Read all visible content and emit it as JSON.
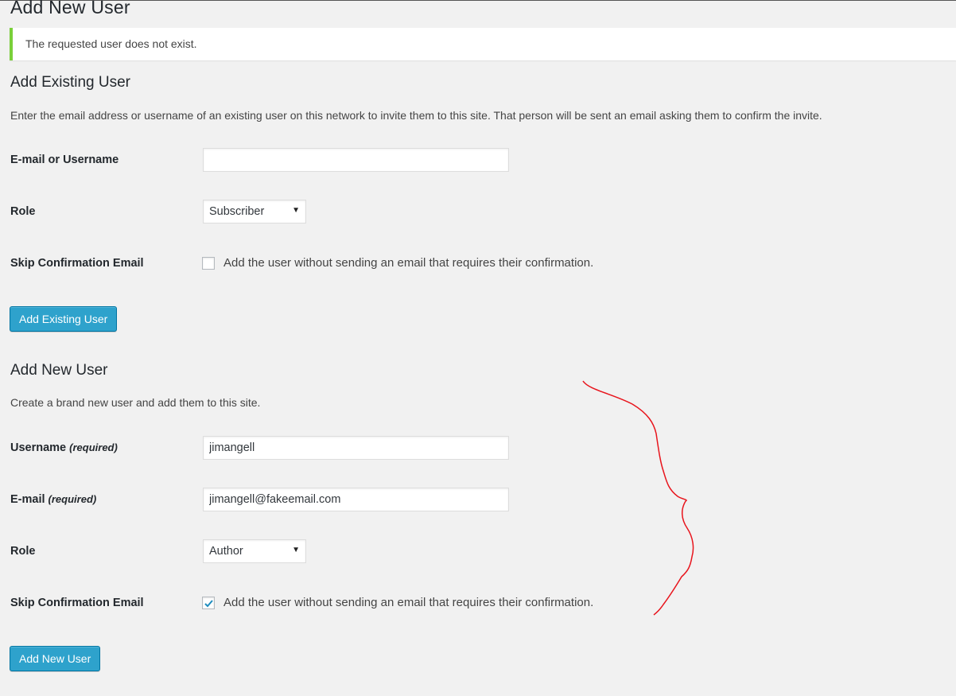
{
  "page_title": "Add New User",
  "notice": {
    "message": "The requested user does not exist.",
    "accent_color": "#7ad03a"
  },
  "add_existing": {
    "heading": "Add Existing User",
    "description": "Enter the email address or username of an existing user on this network to invite them to this site. That person will be sent an email asking them to confirm the invite.",
    "email_label": "E-mail or Username",
    "email_value": "",
    "role_label": "Role",
    "role_value": "Subscriber",
    "skip_label": "Skip Confirmation Email",
    "skip_checked": false,
    "skip_text": "Add the user without sending an email that requires their confirmation.",
    "submit_label": "Add Existing User"
  },
  "add_new": {
    "heading": "Add New User",
    "description": "Create a brand new user and add them to this site.",
    "username_label": "Username",
    "username_required": "(required)",
    "username_value": "jimangell",
    "email_label": "E-mail",
    "email_required": "(required)",
    "email_value": "jimangell@fakeemail.com",
    "role_label": "Role",
    "role_value": "Author",
    "skip_label": "Skip Confirmation Email",
    "skip_checked": true,
    "skip_text": "Add the user without sending an email that requires their confirmation.",
    "submit_label": "Add New User"
  },
  "colors": {
    "button_bg": "#2ea2cc",
    "button_border": "#0074a2",
    "annotation_stroke": "#e8141c",
    "checkmark": "#1e8cbe"
  }
}
